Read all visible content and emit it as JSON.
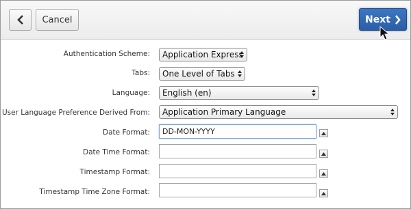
{
  "toolbar": {
    "back_icon": "chevron-left-icon",
    "cancel_label": "Cancel",
    "next_label": "Next",
    "next_icon": "chevron-right-icon",
    "next_color": "#2f64ad"
  },
  "form": {
    "authentication_scheme": {
      "label": "Authentication Scheme:",
      "value": "Application Express"
    },
    "tabs": {
      "label": "Tabs:",
      "value": "One Level of Tabs"
    },
    "language": {
      "label": "Language:",
      "value": "English (en)"
    },
    "user_language_pref": {
      "label": "User Language Preference Derived From:",
      "value": "Application Primary Language"
    },
    "date_format": {
      "label": "Date Format:",
      "value": "DD-MON-YYYY"
    },
    "date_time_format": {
      "label": "Date Time Format:",
      "value": ""
    },
    "timestamp_format": {
      "label": "Timestamp Format:",
      "value": ""
    },
    "timestamp_tz_format": {
      "label": "Timestamp Time Zone Format:",
      "value": ""
    }
  }
}
